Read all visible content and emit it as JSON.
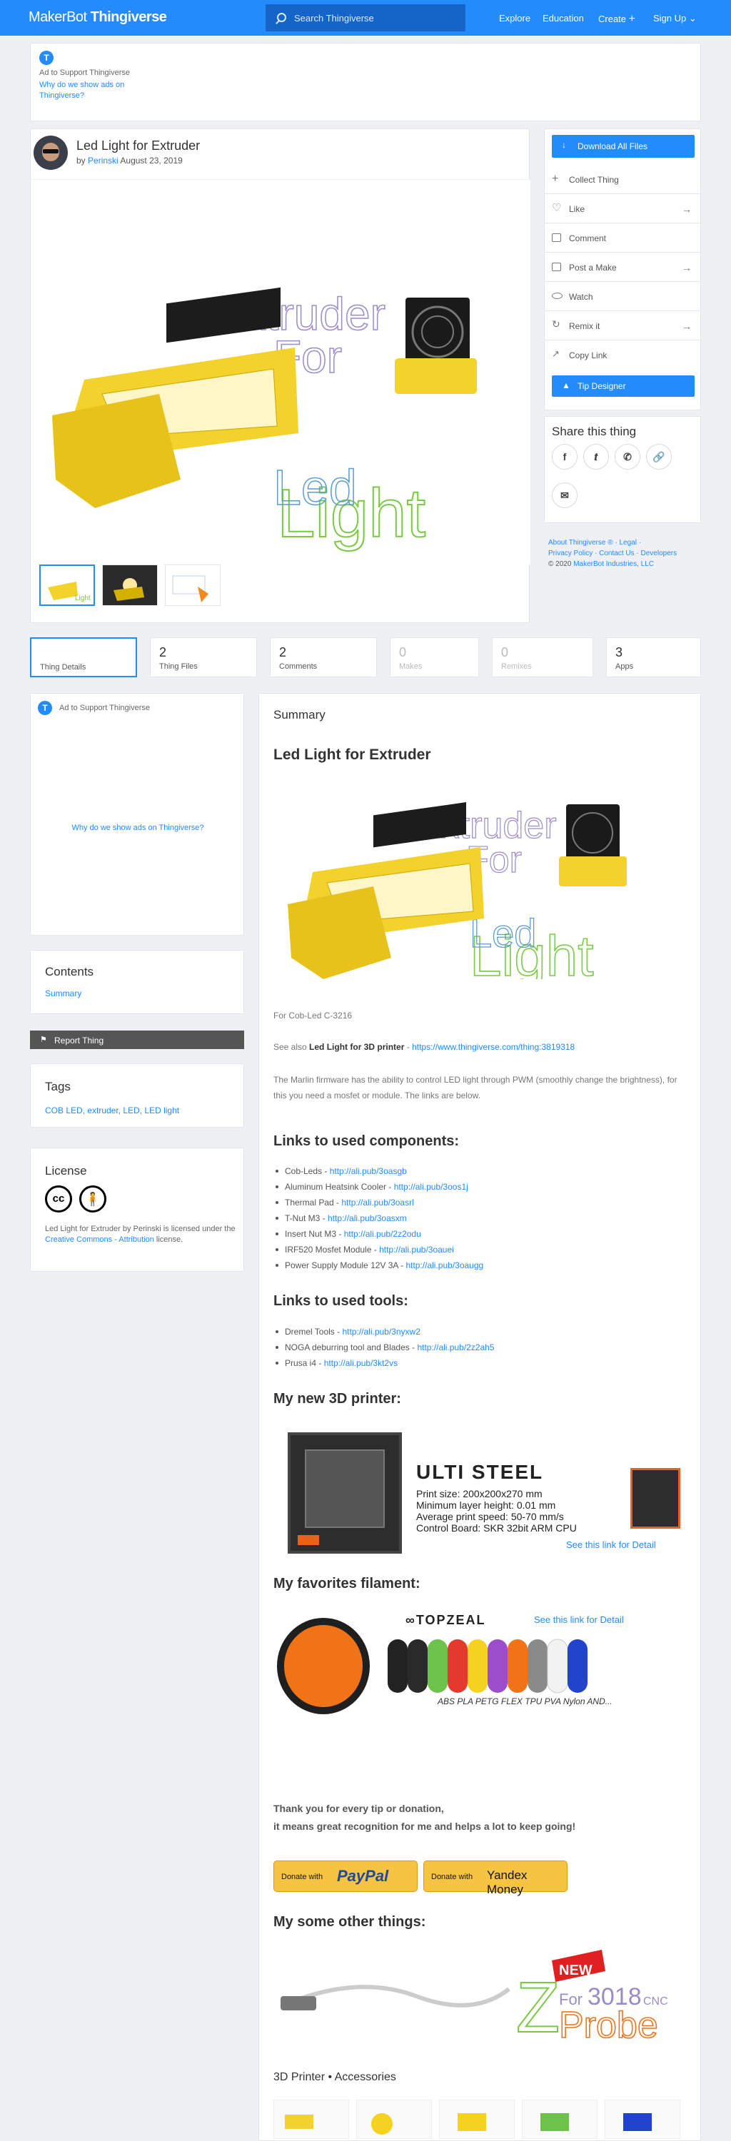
{
  "header": {
    "logo_light": "MakerBot",
    "logo_bold": "Thingiverse",
    "search_placeholder": "Search Thingiverse",
    "nav": [
      "Explore",
      "Education",
      "Create",
      "Sign Up"
    ]
  },
  "ad_top": {
    "label": "Ad to Support Thingiverse",
    "why_link": "Why do we show ads on Thingiverse?"
  },
  "thing": {
    "title": "Led Light for Extruder",
    "by": "by",
    "author": "Perinski",
    "date": "August 23, 2019"
  },
  "image_text": {
    "line1": "Extruder",
    "line2": "For",
    "line3": "Led",
    "line4": "Light"
  },
  "side_actions": {
    "download": "Download All Files",
    "collect": "Collect Thing",
    "like": "Like",
    "comment": "Comment",
    "post_make": "Post a Make",
    "watch": "Watch",
    "remix": "Remix it",
    "copy_link": "Copy Link",
    "tip": "Tip Designer"
  },
  "share": {
    "title": "Share this thing",
    "icons": [
      "f",
      "t",
      "w",
      "link",
      "mail"
    ]
  },
  "footer_links": {
    "line1a": "About Thingiverse ®",
    "line1b": "Legal",
    "line2a": "Privacy Policy",
    "line2b": "Contact Us",
    "line2c": "Developers",
    "copy": "© 2020",
    "company": "MakerBot Industries, LLC"
  },
  "tabs": [
    {
      "count": "",
      "label": "Thing Details"
    },
    {
      "count": "2",
      "label": "Thing Files"
    },
    {
      "count": "2",
      "label": "Comments"
    },
    {
      "count": "0",
      "label": "Makes"
    },
    {
      "count": "0",
      "label": "Remixes"
    },
    {
      "count": "3",
      "label": "Apps"
    }
  ],
  "left_ad": {
    "label": "Ad to Support Thingiverse",
    "why": "Why do we show ads on Thingiverse?"
  },
  "contents": {
    "title": "Contents",
    "item": "Summary"
  },
  "report": "Report Thing",
  "tags": {
    "title": "Tags",
    "list": "COB LED, extruder, LED, LED light"
  },
  "license": {
    "title": "License",
    "text_prefix": "Led Light for Extruder by Perinski is licensed under the",
    "link": "Creative Commons - Attribution",
    "suffix": "license."
  },
  "summary": {
    "label": "Summary",
    "heading": "Led Light for Extruder",
    "for_text": "For Cob-Led C-3216",
    "see_also": "See also",
    "see_also_bold": "Led Light for 3D printer",
    "see_also_link": "https://www.thingiverse.com/thing:3819318",
    "marlin": "The Marlin firmware has the ability to control LED light through PWM (smoothly change the brightness), for this you need a mosfet or module. The links are below."
  },
  "components": {
    "heading": "Links to used components:",
    "items": [
      {
        "name": "Cob-Leds - ",
        "link": "http://ali.pub/3oasgb"
      },
      {
        "name": "Aluminum Heatsink Cooler - ",
        "link": "http://ali.pub/3oos1j"
      },
      {
        "name": "Thermal Pad - ",
        "link": "http://ali.pub/3oasrl"
      },
      {
        "name": "T-Nut M3 - ",
        "link": "http://ali.pub/3oasxm"
      },
      {
        "name": "Insert Nut M3 - ",
        "link": "http://ali.pub/2z2odu"
      },
      {
        "name": "IRF520 Mosfet Module - ",
        "link": "http://ali.pub/3oauei"
      },
      {
        "name": "Power Supply Module 12V 3A - ",
        "link": "http://ali.pub/3oaugg"
      }
    ]
  },
  "tools": {
    "heading": "Links to used tools:",
    "items": [
      {
        "name": "Dremel Tools - ",
        "link": "http://ali.pub/3nyxw2"
      },
      {
        "name": "NOGA deburring tool and Blades - ",
        "link": "http://ali.pub/2z2ah5"
      },
      {
        "name": "Prusa i4 - ",
        "link": "http://ali.pub/3kt2vs"
      }
    ]
  },
  "printer": {
    "heading": "My new 3D printer:",
    "name": "ULTI STEEL",
    "spec1": "Print size: 200x200x270 mm",
    "spec2": "Minimum layer height: 0.01 mm",
    "spec3": "Average print speed: 50-70 mm/s",
    "spec4": "Control Board: SKR 32bit ARM CPU",
    "detail": "See this link for Detail"
  },
  "filament": {
    "heading": "My favorites filament:",
    "brand": "TOPZEAL",
    "detail": "See this link for Detail",
    "types": "ABS PLA PETG FLEX TPU PVA Nylon AND..."
  },
  "thanks": {
    "line1": "Thank you for every tip or donation,",
    "line2": "it means great recognition for me and helps a lot to keep going!"
  },
  "donate": {
    "paypal_pre": "Donate with",
    "paypal": "PayPal",
    "yandex_pre": "Donate with",
    "yandex": "Yandex Money"
  },
  "other": {
    "heading": "My some other things:",
    "new": "NEW",
    "for": "For",
    "model": "3018",
    "cnc": "CNC",
    "probe": "Probe",
    "category": "3D Printer • Accessories"
  },
  "colors": {
    "accent": "#248bfb",
    "yellow": "#f2d22b",
    "green": "#7ac943",
    "purple": "#9a8bc9"
  }
}
